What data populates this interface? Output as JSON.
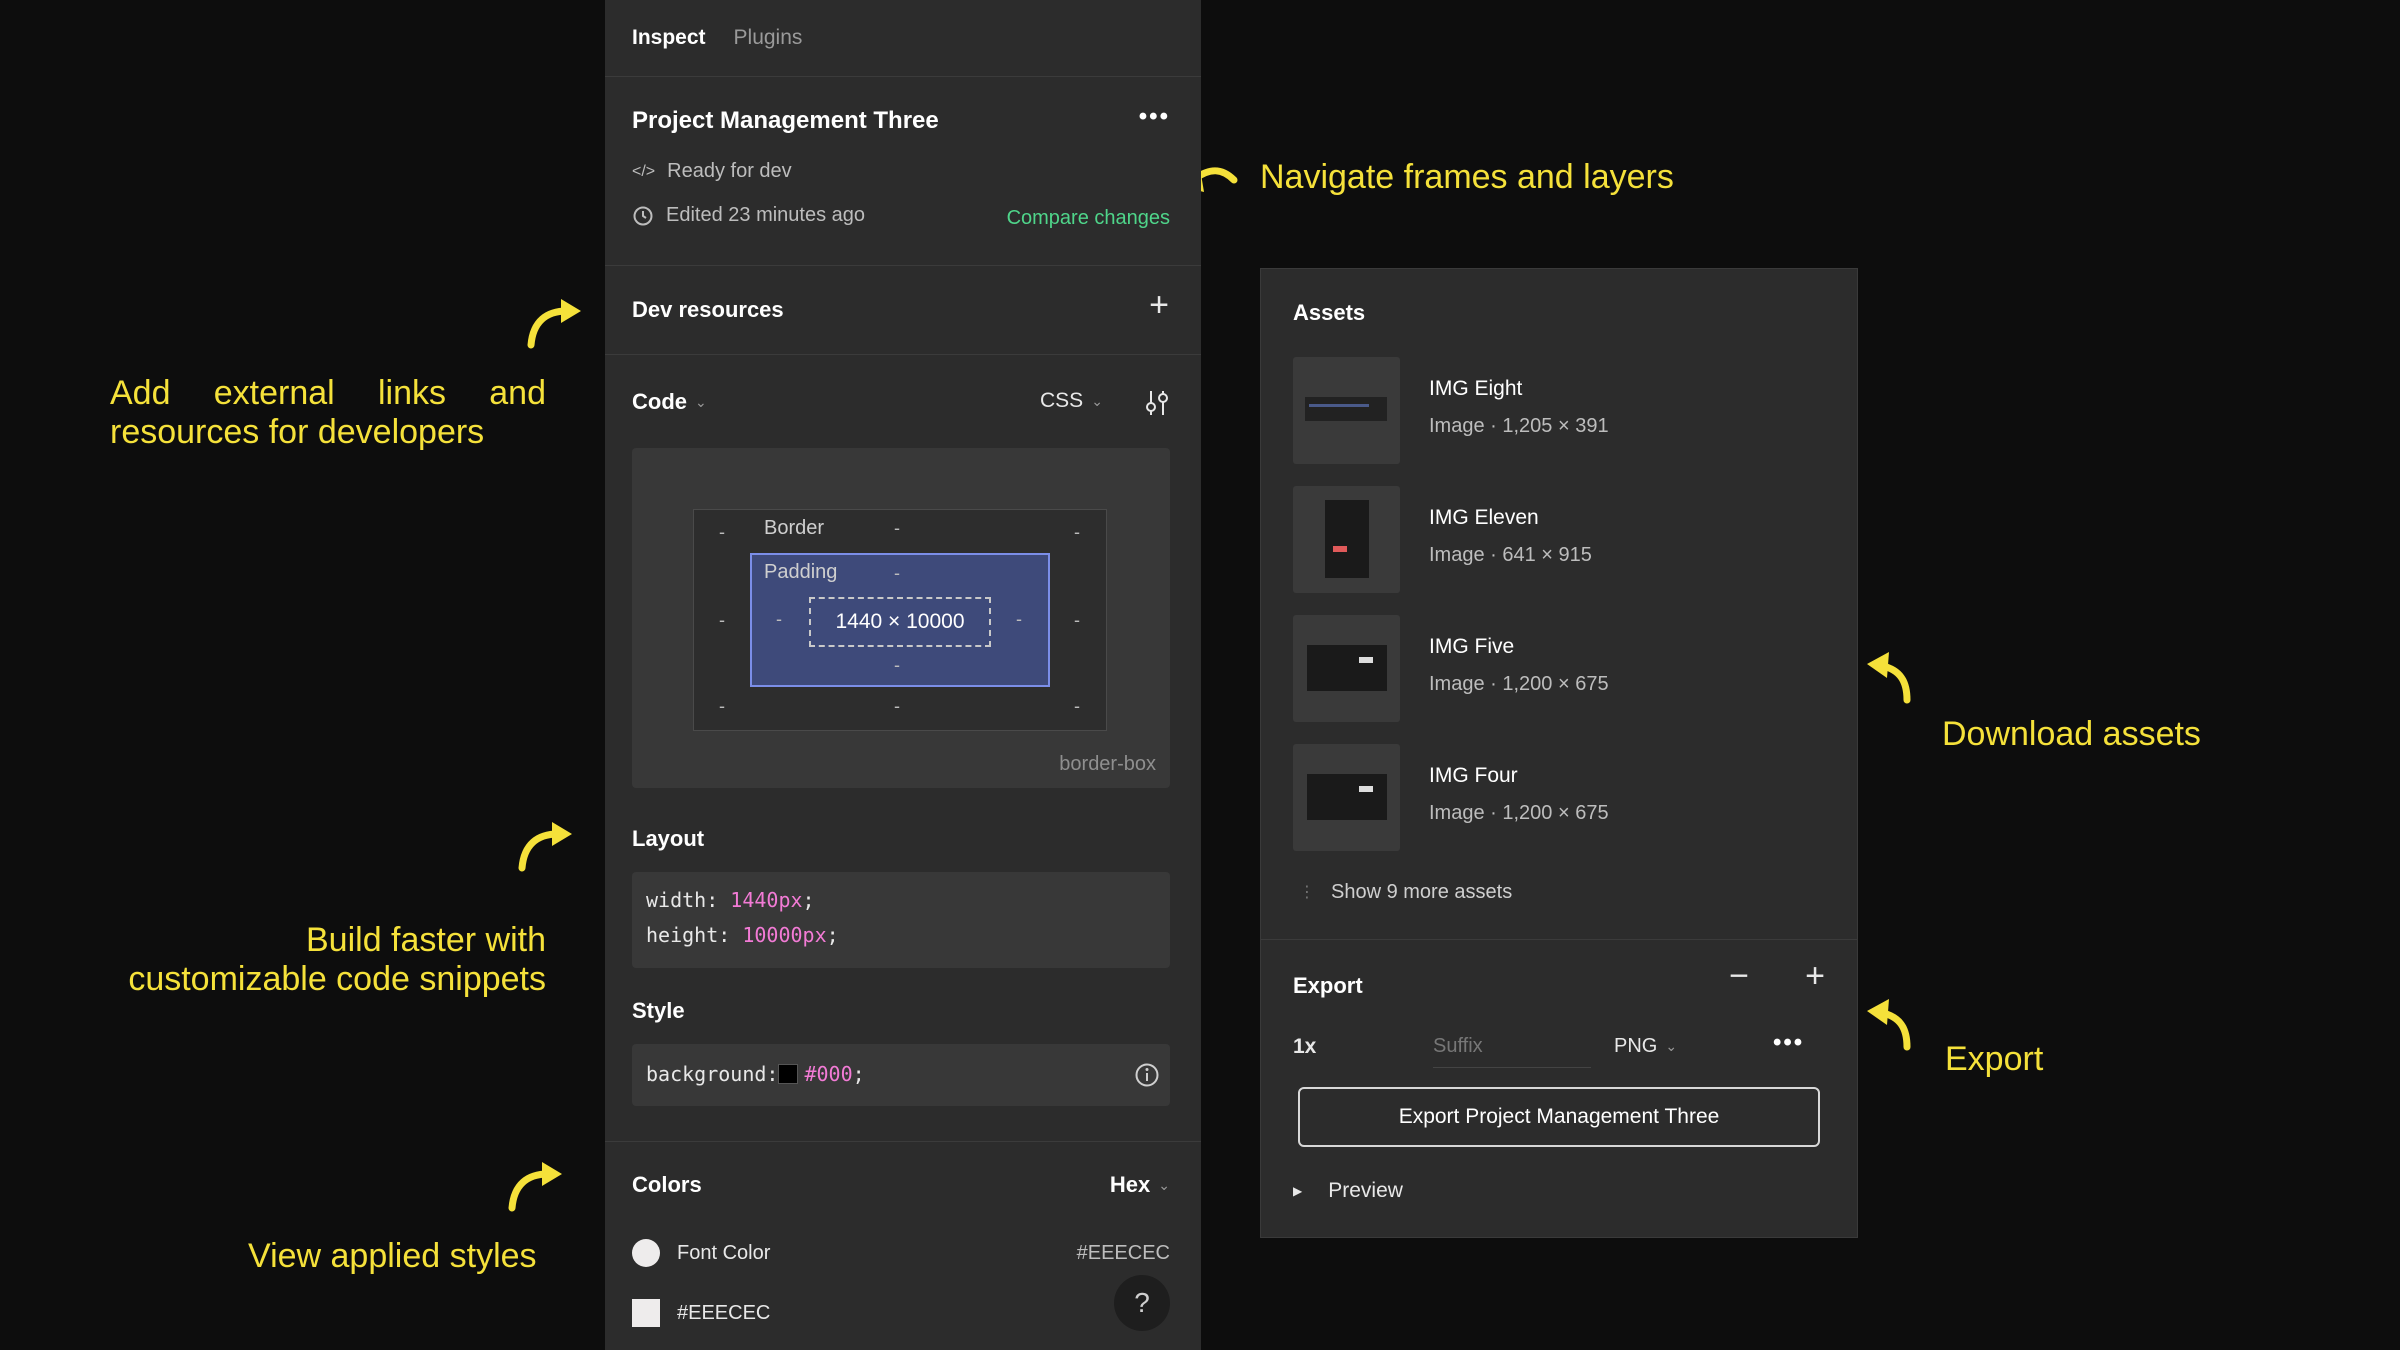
{
  "tabs": {
    "inspect": "Inspect",
    "plugins": "Plugins"
  },
  "frame": {
    "title": "Project Management Three",
    "status": "Ready for dev",
    "edited": "Edited 23 minutes ago",
    "compare": "Compare changes"
  },
  "dev_resources": {
    "title": "Dev resources"
  },
  "code": {
    "title": "Code",
    "language": "CSS",
    "box": {
      "border_label": "Border",
      "padding_label": "Padding",
      "dash": "-",
      "content": "1440 × 10000",
      "sizing": "border-box"
    },
    "layout": {
      "title": "Layout",
      "line1_prop": "width: ",
      "line1_val": "1440px",
      "line2_prop": "height: ",
      "line2_val": "10000px",
      "semi": ";"
    },
    "style": {
      "title": "Style",
      "prop": "background: ",
      "val": "#000",
      "semi": ";",
      "swatch": "#000000"
    }
  },
  "colors": {
    "title": "Colors",
    "format": "Hex",
    "items": [
      {
        "label": "Font Color",
        "value": "#EEECEC",
        "swatch": "#EEECEC"
      },
      {
        "label": "#EEECEC",
        "swatch": "#EEECEC"
      }
    ],
    "help": "?"
  },
  "assets": {
    "title": "Assets",
    "items": [
      {
        "name": "IMG Eight",
        "meta": "Image · 1,205 × 391"
      },
      {
        "name": "IMG Eleven",
        "meta": "Image · 641 × 915"
      },
      {
        "name": "IMG Five",
        "meta": "Image · 1,200 × 675"
      },
      {
        "name": "IMG Four",
        "meta": "Image · 1,200 × 675"
      }
    ],
    "more": "Show 9 more assets"
  },
  "export": {
    "title": "Export",
    "scale": "1x",
    "suffix_placeholder": "Suffix",
    "format": "PNG",
    "button": "Export Project Management Three",
    "preview": "Preview"
  },
  "annotations": {
    "navigate": "Navigate frames and layers",
    "dev_links_1": "Add external links and",
    "dev_links_2": "resources for developers",
    "build_1": "Build faster with",
    "build_2": "customizable code snippets",
    "view_styles": "View applied styles",
    "download": "Download assets",
    "export": "Export"
  },
  "accent": {
    "annotation": "#F5E13A",
    "compare": "#4FD58A",
    "code_value": "#F37BD6"
  }
}
